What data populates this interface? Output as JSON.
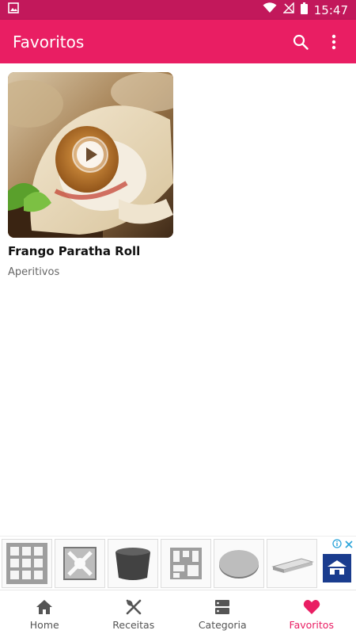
{
  "status_bar": {
    "time": "15:47",
    "icons": [
      "image-notification-icon",
      "wifi-icon",
      "no-signal-icon",
      "battery-icon"
    ]
  },
  "app_bar": {
    "title": "Favoritos",
    "actions": [
      "search-icon",
      "more-vert-icon"
    ]
  },
  "favorites": [
    {
      "title": "Frango Paratha Roll",
      "category": "Aperitivos",
      "has_video": true
    }
  ],
  "ad": {
    "items": [
      "hollow-block-icon",
      "decorative-block-icon",
      "round-planter-icon",
      "decorative-block-icon",
      "round-slab-icon",
      "flat-slab-icon"
    ],
    "info_icon": "info-icon",
    "close_icon": "close-icon",
    "logo": "advertiser-logo"
  },
  "bottom_nav": {
    "items": [
      {
        "label": "Home",
        "icon": "home-icon",
        "active": false
      },
      {
        "label": "Receitas",
        "icon": "cutlery-icon",
        "active": false
      },
      {
        "label": "Categoria",
        "icon": "category-icon",
        "active": false
      },
      {
        "label": "Favoritos",
        "icon": "heart-icon",
        "active": true
      }
    ]
  },
  "colors": {
    "primary": "#e91e63",
    "primary_dark": "#c2185b",
    "inactive_nav": "#555555",
    "active_nav": "#e91e63"
  }
}
